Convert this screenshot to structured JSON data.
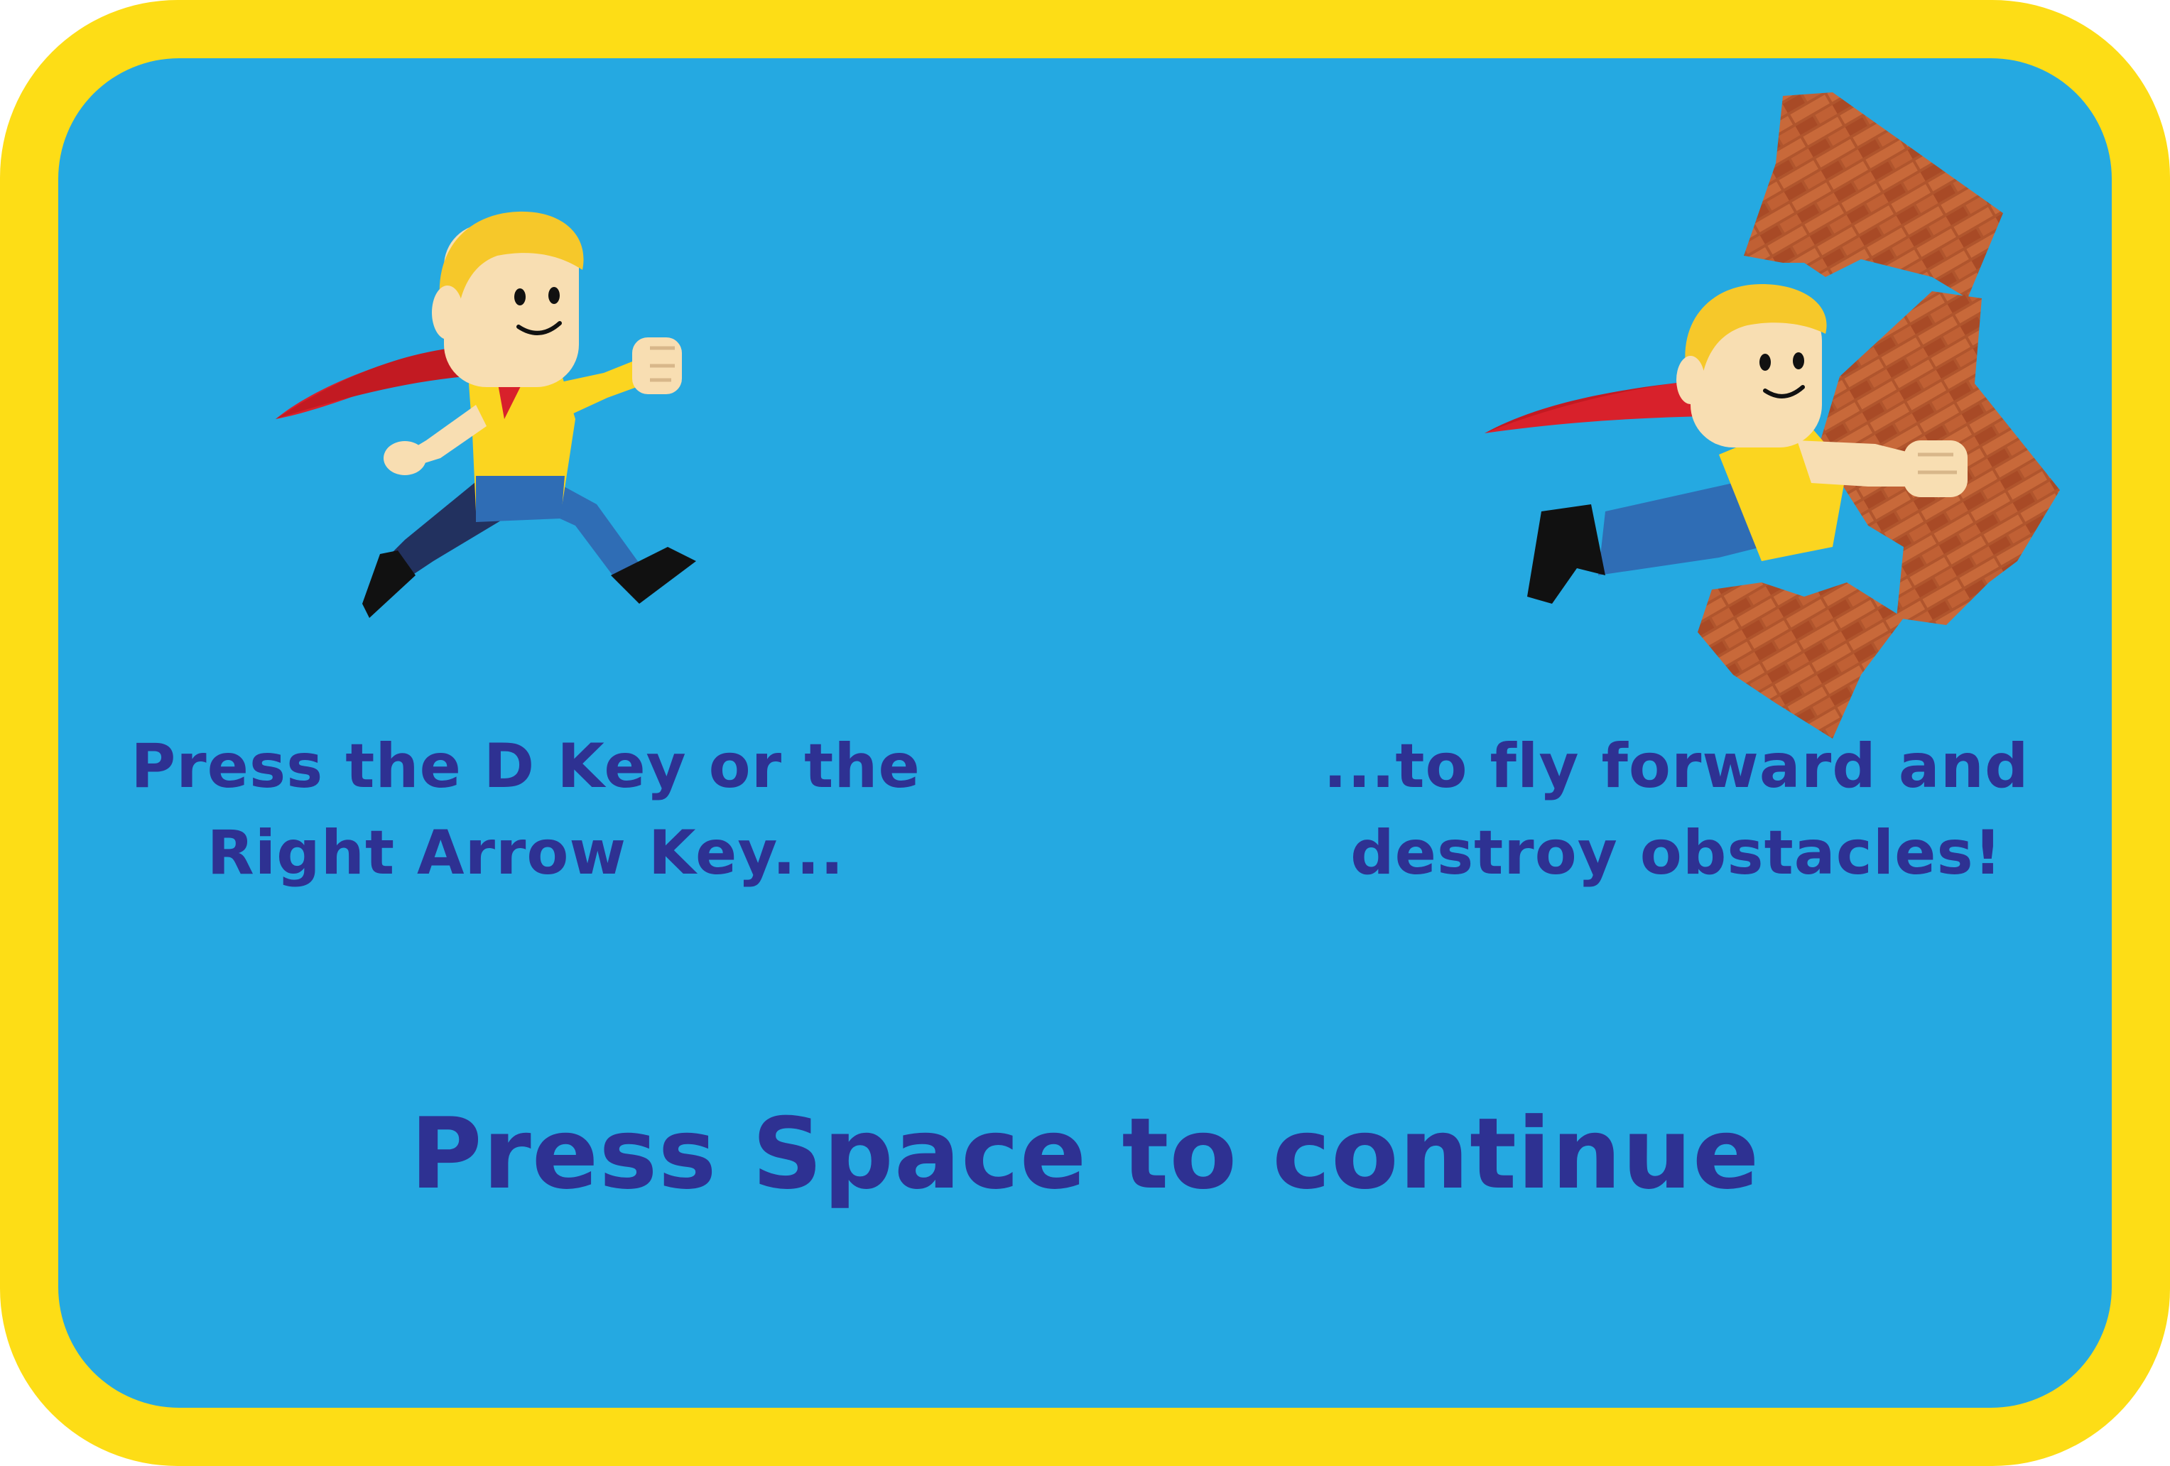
{
  "instructions": {
    "left_line1": "Press the D Key or the",
    "left_line2": "Right Arrow Key...",
    "right_line1": "...to fly forward and",
    "right_line2": "destroy obstacles!"
  },
  "prompt": {
    "continue_label": "Press Space to continue"
  },
  "colors": {
    "frame": "#fddd16",
    "panel": "#25a9e1",
    "text": "#2e3192",
    "hair": "#f6c82a",
    "skin": "#f8deb2",
    "shirt": "#fbd520",
    "cape": "#d8212b",
    "pants": "#2f6db5",
    "brick": "#b0552d"
  },
  "icons": [
    "running-hero-icon",
    "flying-hero-icon",
    "broken-brick-wall-icon"
  ]
}
